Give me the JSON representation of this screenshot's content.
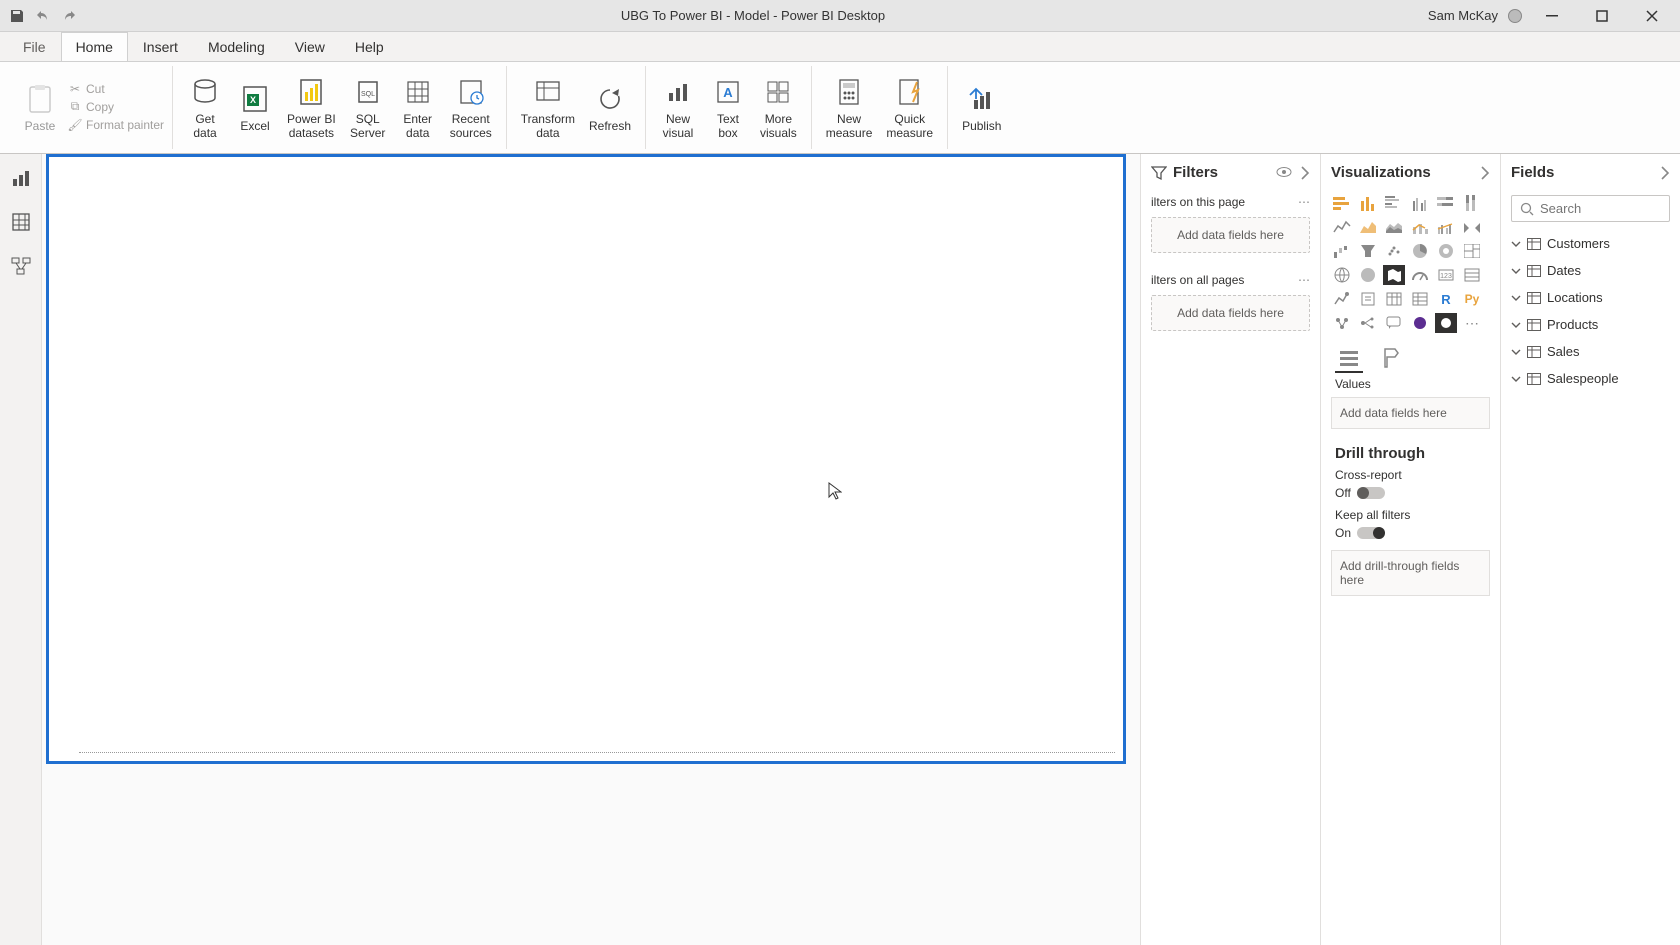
{
  "titlebar": {
    "title": "UBG To Power BI - Model - Power BI Desktop",
    "user": "Sam McKay"
  },
  "tabs": {
    "file": "File",
    "items": [
      "Home",
      "Insert",
      "Modeling",
      "View",
      "Help"
    ],
    "active": "Home"
  },
  "ribbon": {
    "clipboard": {
      "paste": "Paste",
      "cut": "Cut",
      "copy": "Copy",
      "format_painter": "Format painter"
    },
    "data": {
      "get_data": "Get\ndata",
      "excel": "Excel",
      "pbi_datasets": "Power BI\ndatasets",
      "sql_server": "SQL\nServer",
      "enter_data": "Enter\ndata",
      "recent_sources": "Recent\nsources"
    },
    "queries": {
      "transform": "Transform\ndata",
      "refresh": "Refresh"
    },
    "insert": {
      "new_visual": "New\nvisual",
      "text_box": "Text\nbox",
      "more_visuals": "More\nvisuals"
    },
    "calc": {
      "new_measure": "New\nmeasure",
      "quick_measure": "Quick\nmeasure"
    },
    "share": {
      "publish": "Publish"
    }
  },
  "filters": {
    "title": "Filters",
    "on_page": "ilters on this page",
    "on_all": "ilters on all pages",
    "placeholder": "Add data fields here"
  },
  "viz": {
    "title": "Visualizations",
    "values": "Values",
    "values_placeholder": "Add data fields here",
    "drill": "Drill through",
    "cross_report": "Cross-report",
    "cross_value": "Off",
    "keep_filters": "Keep all filters",
    "keep_value": "On",
    "drill_placeholder": "Add drill-through fields here"
  },
  "fields": {
    "title": "Fields",
    "search_placeholder": "Search",
    "tables": [
      "Customers",
      "Dates",
      "Locations",
      "Products",
      "Sales",
      "Salespeople"
    ]
  }
}
